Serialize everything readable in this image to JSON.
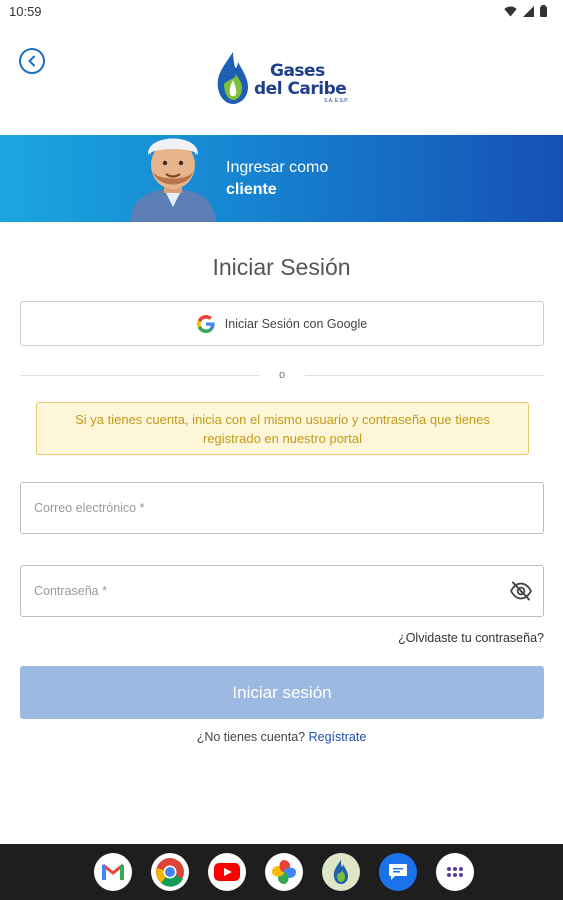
{
  "status_bar": {
    "time": "10:59",
    "icons": [
      "wifi-icon",
      "signal-icon",
      "battery-icon"
    ]
  },
  "header": {
    "back_icon": "chevron-left-circle-icon",
    "logo": {
      "line1": "Gases",
      "line2": "del Caribe",
      "suffix": "S.A. E.S.P."
    }
  },
  "banner": {
    "line1": "Ingresar como",
    "line2": "cliente"
  },
  "form": {
    "title": "Iniciar Sesión",
    "google_button_label": "Iniciar Sesión con Google",
    "divider_text": "o",
    "info_message": "Si ya tienes cuenta, inicia con el mismo usuario y contraseña que tienes registrado en nuestro portal",
    "email": {
      "placeholder": "Correo electrónico *",
      "value": ""
    },
    "password": {
      "placeholder": "Contraseña *",
      "value": ""
    },
    "forgot_password_label": "¿Olvidaste tu contraseña?",
    "submit_label": "Iniciar sesión",
    "register_prompt": "¿No tienes cuenta?",
    "register_link": "Regístrate"
  },
  "dock": {
    "apps": [
      {
        "name": "gmail-icon"
      },
      {
        "name": "chrome-icon"
      },
      {
        "name": "youtube-icon"
      },
      {
        "name": "photos-icon"
      },
      {
        "name": "gases-del-caribe-app-icon"
      },
      {
        "name": "messages-icon"
      },
      {
        "name": "app-drawer-icon"
      }
    ]
  },
  "colors": {
    "primary_blue": "#1d6fc2",
    "button_disabled": "#9cb9e2",
    "info_bg": "#fdf6d8",
    "info_text": "#c29b1c",
    "brand_dark": "#1f3f8c"
  }
}
